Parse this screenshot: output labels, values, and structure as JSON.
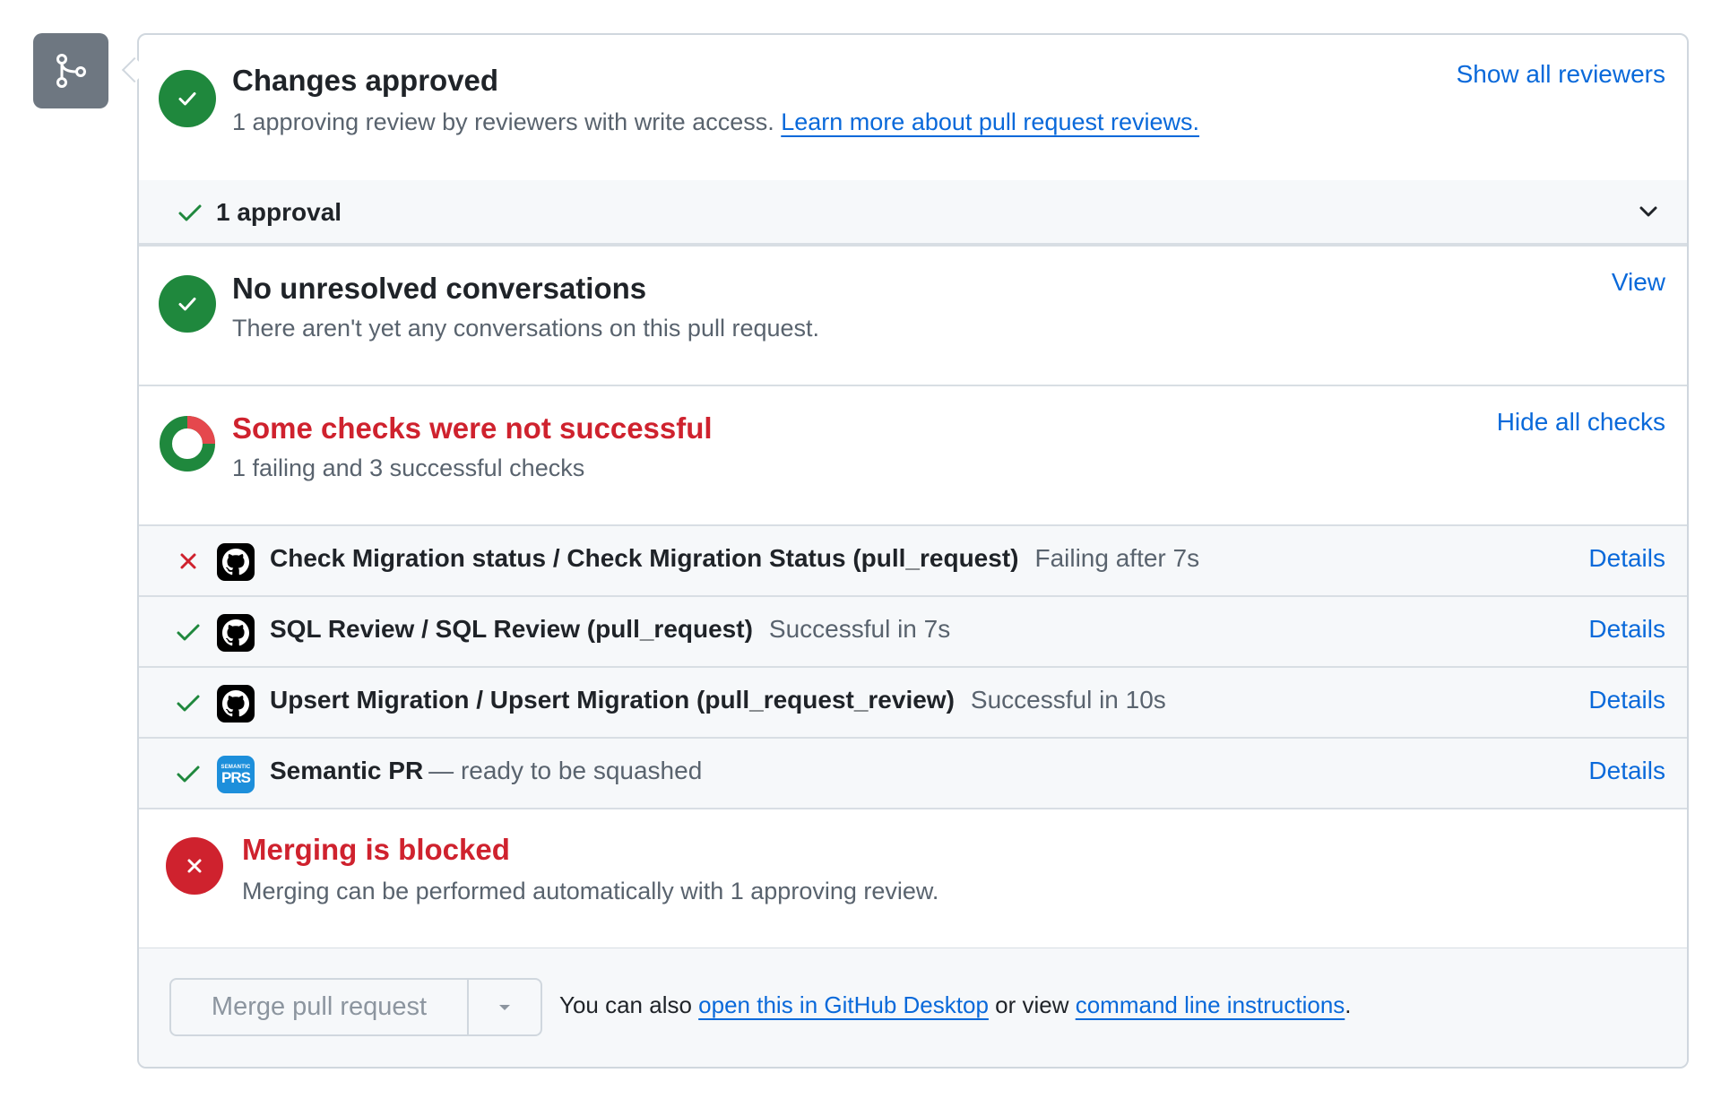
{
  "badge": {
    "icon": "git-merge-icon"
  },
  "approvals": {
    "title": "Changes approved",
    "description": "1 approving review by reviewers with write access.",
    "learn_more_link": "Learn more about pull request reviews.",
    "show_reviewers_link": "Show all reviewers",
    "approval_summary": "1 approval"
  },
  "conversations": {
    "title": "No unresolved conversations",
    "description": "There aren't yet any conversations on this pull request.",
    "view_link": "View"
  },
  "checks": {
    "title": "Some checks were not successful",
    "description": "1 failing and 3 successful checks",
    "toggle_link": "Hide all checks",
    "failing_count": 1,
    "successful_count": 3,
    "items": [
      {
        "status": "failure",
        "app": "github-actions",
        "name": "Check Migration status / Check Migration Status (pull_request)",
        "meta": "Failing after 7s",
        "details": "Details"
      },
      {
        "status": "success",
        "app": "github-actions",
        "name": "SQL Review / SQL Review (pull_request)",
        "meta": "Successful in 7s",
        "details": "Details"
      },
      {
        "status": "success",
        "app": "github-actions",
        "name": "Upsert Migration / Upsert Migration (pull_request_review)",
        "meta": "Successful in 10s",
        "details": "Details"
      },
      {
        "status": "success",
        "app": "semantic-prs",
        "name": "Semantic PR",
        "meta": "— ready to be squashed",
        "details": "Details",
        "app_label_small": "SEMANTIC",
        "app_label_big": "PRS"
      }
    ]
  },
  "merge_status": {
    "title": "Merging is blocked",
    "description": "Merging can be performed automatically with 1 approving review."
  },
  "footer": {
    "merge_button": "Merge pull request",
    "note_prefix": "You can also ",
    "desktop_link": "open this in GitHub Desktop",
    "note_middle": " or view ",
    "cli_link": "command line instructions",
    "note_suffix": "."
  },
  "colors": {
    "success": "#1f883d",
    "danger": "#cf222e",
    "link": "#0969da",
    "muted": "#59636e"
  }
}
